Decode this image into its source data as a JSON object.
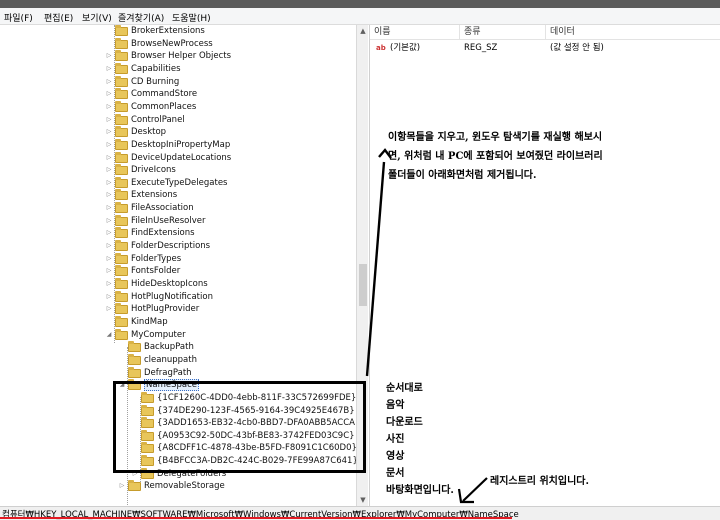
{
  "menu": [
    "파일(F)",
    "편집(E)",
    "보기(V)",
    "즐겨찾기(A)",
    "도움말(H)"
  ],
  "tree": [
    {
      "label": "BrokerExtensions",
      "level": 0,
      "exp": ""
    },
    {
      "label": "BrowseNewProcess",
      "level": 0,
      "exp": ""
    },
    {
      "label": "Browser Helper Objects",
      "level": 0,
      "exp": "▷"
    },
    {
      "label": "Capabilities",
      "level": 0,
      "exp": "▷"
    },
    {
      "label": "CD Burning",
      "level": 0,
      "exp": "▷"
    },
    {
      "label": "CommandStore",
      "level": 0,
      "exp": "▷"
    },
    {
      "label": "CommonPlaces",
      "level": 0,
      "exp": "▷"
    },
    {
      "label": "ControlPanel",
      "level": 0,
      "exp": "▷"
    },
    {
      "label": "Desktop",
      "level": 0,
      "exp": "▷"
    },
    {
      "label": "DesktopIniPropertyMap",
      "level": 0,
      "exp": "▷"
    },
    {
      "label": "DeviceUpdateLocations",
      "level": 0,
      "exp": "▷"
    },
    {
      "label": "DriveIcons",
      "level": 0,
      "exp": "▷"
    },
    {
      "label": "ExecuteTypeDelegates",
      "level": 0,
      "exp": "▷"
    },
    {
      "label": "Extensions",
      "level": 0,
      "exp": "▷"
    },
    {
      "label": "FileAssociation",
      "level": 0,
      "exp": "▷"
    },
    {
      "label": "FileInUseResolver",
      "level": 0,
      "exp": "▷"
    },
    {
      "label": "FindExtensions",
      "level": 0,
      "exp": "▷"
    },
    {
      "label": "FolderDescriptions",
      "level": 0,
      "exp": "▷"
    },
    {
      "label": "FolderTypes",
      "level": 0,
      "exp": "▷"
    },
    {
      "label": "FontsFolder",
      "level": 0,
      "exp": "▷"
    },
    {
      "label": "HideDesktopIcons",
      "level": 0,
      "exp": "▷"
    },
    {
      "label": "HotPlugNotification",
      "level": 0,
      "exp": "▷"
    },
    {
      "label": "HotPlugProvider",
      "level": 0,
      "exp": "▷"
    },
    {
      "label": "KindMap",
      "level": 0,
      "exp": ""
    },
    {
      "label": "MyComputer",
      "level": 0,
      "exp": "◢"
    },
    {
      "label": "BackupPath",
      "level": 1,
      "exp": ""
    },
    {
      "label": "cleanuppath",
      "level": 1,
      "exp": ""
    },
    {
      "label": "DefragPath",
      "level": 1,
      "exp": ""
    },
    {
      "label": "NameSpace",
      "level": 1,
      "exp": "◢",
      "selected": true
    },
    {
      "label": "{1CF1260C-4DD0-4ebb-811F-33C572699FDE}",
      "level": 2,
      "exp": ""
    },
    {
      "label": "{374DE290-123F-4565-9164-39C4925E467B}",
      "level": 2,
      "exp": ""
    },
    {
      "label": "{3ADD1653-EB32-4cb0-BBD7-DFA0ABB5ACCA}",
      "level": 2,
      "exp": ""
    },
    {
      "label": "{A0953C92-50DC-43bf-BE83-3742FED03C9C}",
      "level": 2,
      "exp": ""
    },
    {
      "label": "{A8CDFF1C-4878-43be-B5FD-F8091C1C60D0}",
      "level": 2,
      "exp": ""
    },
    {
      "label": "{B4BFCC3A-DB2C-424C-B029-7FE99A87C641}",
      "level": 2,
      "exp": ""
    },
    {
      "label": "DelegateFolders",
      "level": 2,
      "exp": "▷"
    },
    {
      "label": "RemovableStorage",
      "level": 1,
      "exp": "▷"
    }
  ],
  "columns": {
    "name": "이름",
    "type": "종류",
    "data": "데이터"
  },
  "value_row": {
    "icon": "ab",
    "name": "(기본값)",
    "type": "REG_SZ",
    "data": "(값 설정 안 됨)"
  },
  "status_path": "컴퓨터₩HKEY_LOCAL_MACHINE₩SOFTWARE₩Microsoft₩Windows₩CurrentVersion₩Explorer₩MyComputer₩NameSpace",
  "notes": {
    "top": "이항목들을 지우고, 윈도우 탐색기를 재실행 해보시면, 위처럼 내 PC에 포함되어 보여줬던 라이브러리 폴더들이 아래화면처럼 제거됩니다.",
    "list": [
      "순서대로",
      "음악",
      "다운로드",
      "사진",
      "영상",
      "문서",
      "바탕화면입니다."
    ],
    "location": "레지스트리 위치입니다."
  },
  "colors": {
    "annotation": "#000000",
    "underline": "#e31b23",
    "folder": "#e8c65a"
  }
}
